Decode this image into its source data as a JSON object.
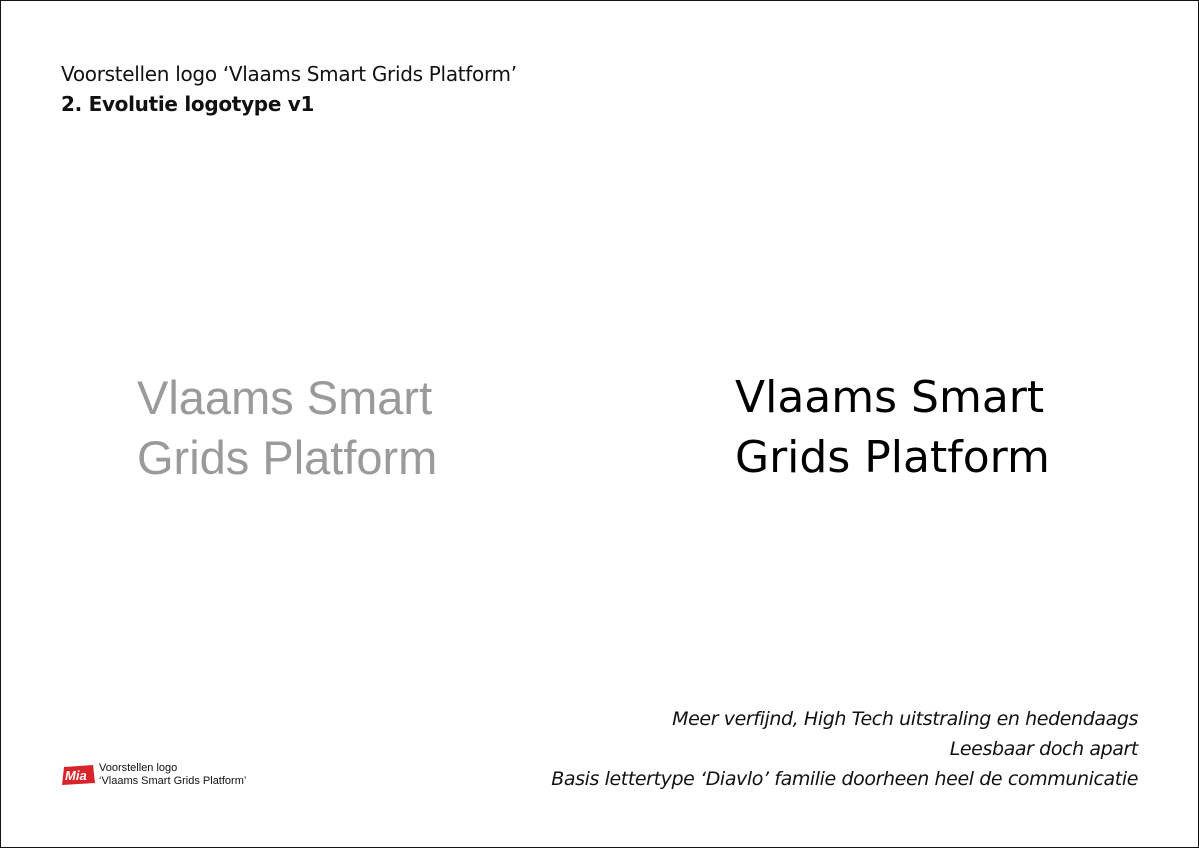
{
  "header": {
    "title": "Voorstellen logo ‘Vlaams Smart Grids Platform’",
    "subtitle": "2. Evolutie logotype v1"
  },
  "logos": {
    "left": {
      "line1": "Vlaams Smart",
      "line2": "Grids Platform",
      "color": "#9a9a9a"
    },
    "right": {
      "line1": "Vlaams Smart",
      "line2": "Grids Platform",
      "color": "#000000"
    }
  },
  "description": {
    "lines": [
      "Meer verfijnd, High Tech uitstraling en hedendaags",
      "Leesbaar doch apart",
      "Basis lettertype ‘Diavlo’ familie doorheen heel de communicatie"
    ]
  },
  "footer": {
    "logo_text": "Mia",
    "logo_color": "#d8232a",
    "line1": "Voorstellen logo",
    "line2": "‘Vlaams Smart Grids Platform’"
  }
}
